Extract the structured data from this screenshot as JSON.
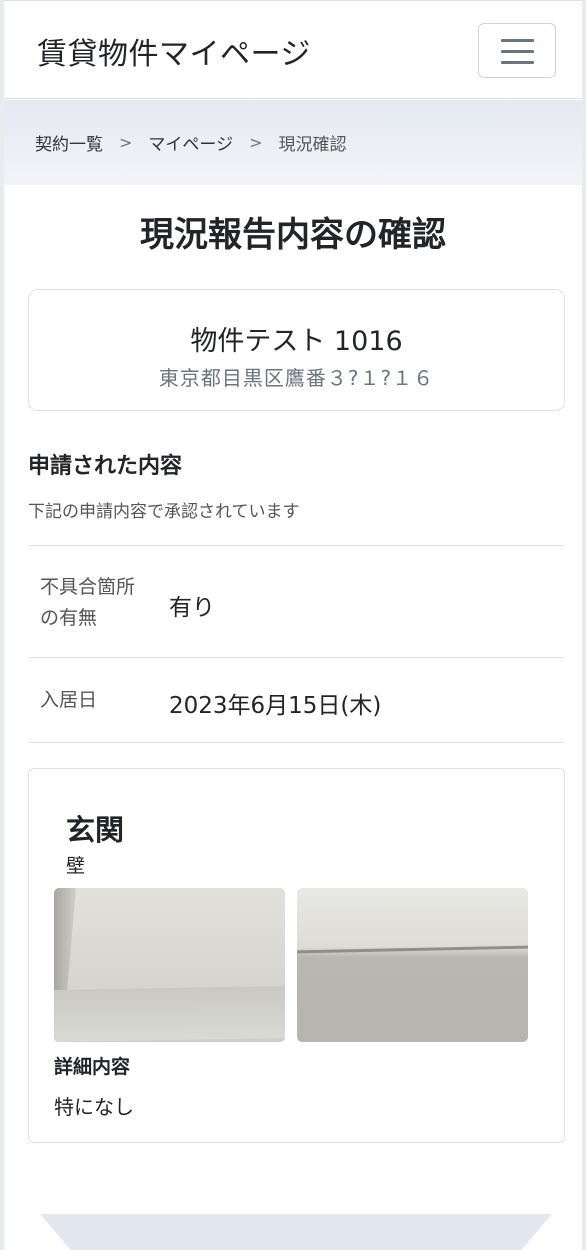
{
  "navbar": {
    "brand": "賃貸物件マイページ",
    "menu_icon": "hamburger-menu-icon"
  },
  "breadcrumb": {
    "items": [
      "契約一覧",
      "マイページ",
      "現況確認"
    ],
    "separator": ">"
  },
  "page_title": "現況報告内容の確認",
  "property": {
    "name": "物件テスト 1016",
    "address": "東京都目黒区鷹番３?１?１６"
  },
  "request": {
    "title": "申請された内容",
    "subtitle": "下記の申請内容で承認されています",
    "rows": [
      {
        "label": "不具合箇所の有無",
        "value": "有り"
      },
      {
        "label": "入居日",
        "value": "2023年6月15日(木)"
      }
    ]
  },
  "detail": {
    "place": "玄関",
    "part": "壁",
    "photos": [
      "wall-photo-1",
      "wall-photo-2"
    ],
    "detail_label": "詳細内容",
    "detail_value": "特になし"
  },
  "colors": {
    "breadcrumb_bg": "#e5e9f1",
    "border": "#dee2e6",
    "muted_text": "#6c757d"
  }
}
